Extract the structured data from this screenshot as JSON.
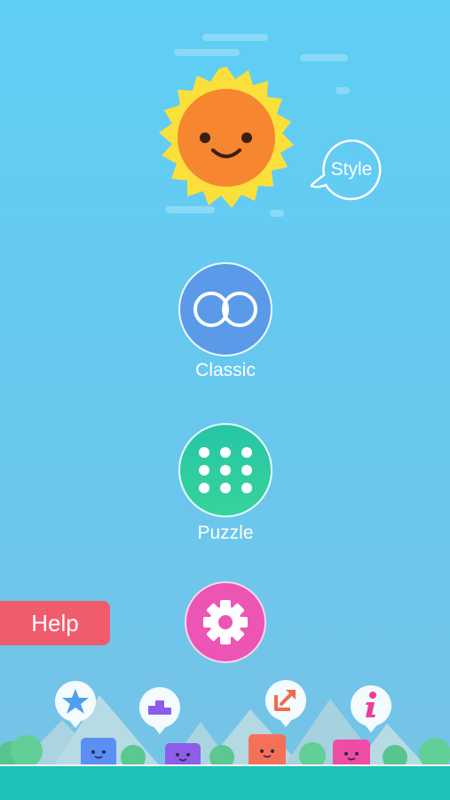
{
  "menu": {
    "style_label": "Style",
    "classic_label": "Classic",
    "puzzle_label": "Puzzle",
    "help_label": "Help"
  },
  "colors": {
    "sky_top": "#5fcff5",
    "sun_face": "#f6862f",
    "sun_rays": "#fbe03c",
    "classic": "#5a9ae8",
    "puzzle": "#2ecc9f",
    "settings": "#ec55b4",
    "help": "#f15c6d",
    "ground": "#1fc0b8"
  },
  "bottom_icons": [
    "star-icon",
    "leaderboard-icon",
    "share-icon",
    "info-icon"
  ]
}
